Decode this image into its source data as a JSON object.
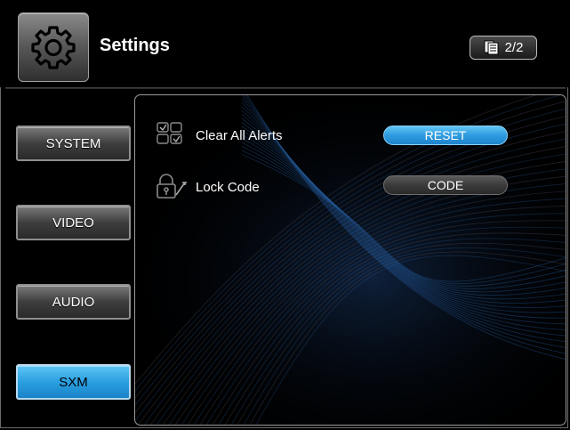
{
  "header": {
    "title": "Settings",
    "icon": "gear-icon",
    "page_indicator": "2/2",
    "page_indicator_icon": "pages-icon"
  },
  "sidebar": {
    "items": [
      {
        "label": "SYSTEM",
        "active": false
      },
      {
        "label": "VIDEO",
        "active": false
      },
      {
        "label": "AUDIO",
        "active": false
      },
      {
        "label": "SXM",
        "active": true
      }
    ]
  },
  "content": {
    "rows": [
      {
        "icon": "alerts-grid-icon",
        "label": "Clear All Alerts",
        "button": "RESET",
        "button_style": "highlighted"
      },
      {
        "icon": "lock-code-icon",
        "label": "Lock Code",
        "button": "CODE",
        "button_style": "normal"
      }
    ]
  },
  "colors": {
    "accent": "#2e9be0",
    "background": "#000000",
    "tab_default": "#3e3e3e"
  }
}
